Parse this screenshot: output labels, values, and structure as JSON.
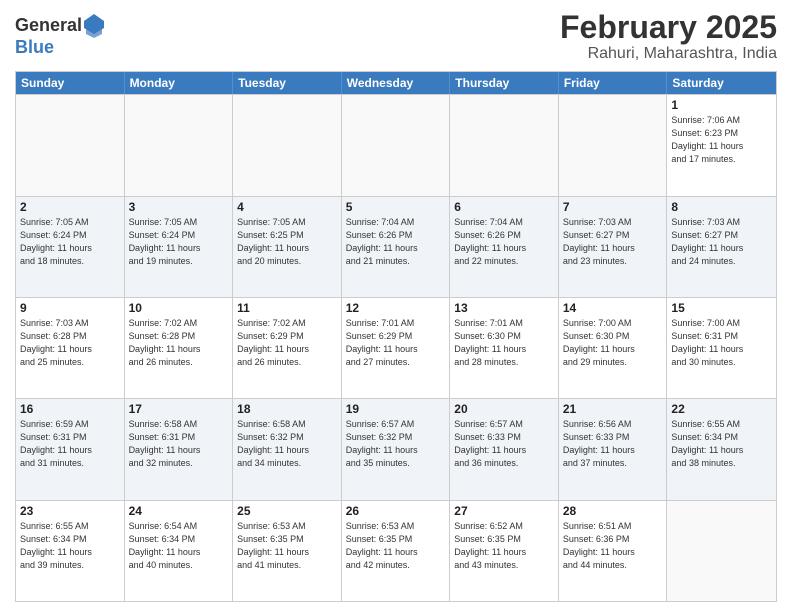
{
  "header": {
    "logo_general": "General",
    "logo_blue": "Blue",
    "title": "February 2025",
    "subtitle": "Rahuri, Maharashtra, India"
  },
  "weekdays": [
    "Sunday",
    "Monday",
    "Tuesday",
    "Wednesday",
    "Thursday",
    "Friday",
    "Saturday"
  ],
  "weeks": [
    [
      {
        "day": "",
        "info": ""
      },
      {
        "day": "",
        "info": ""
      },
      {
        "day": "",
        "info": ""
      },
      {
        "day": "",
        "info": ""
      },
      {
        "day": "",
        "info": ""
      },
      {
        "day": "",
        "info": ""
      },
      {
        "day": "1",
        "info": "Sunrise: 7:06 AM\nSunset: 6:23 PM\nDaylight: 11 hours\nand 17 minutes."
      }
    ],
    [
      {
        "day": "2",
        "info": "Sunrise: 7:05 AM\nSunset: 6:24 PM\nDaylight: 11 hours\nand 18 minutes."
      },
      {
        "day": "3",
        "info": "Sunrise: 7:05 AM\nSunset: 6:24 PM\nDaylight: 11 hours\nand 19 minutes."
      },
      {
        "day": "4",
        "info": "Sunrise: 7:05 AM\nSunset: 6:25 PM\nDaylight: 11 hours\nand 20 minutes."
      },
      {
        "day": "5",
        "info": "Sunrise: 7:04 AM\nSunset: 6:26 PM\nDaylight: 11 hours\nand 21 minutes."
      },
      {
        "day": "6",
        "info": "Sunrise: 7:04 AM\nSunset: 6:26 PM\nDaylight: 11 hours\nand 22 minutes."
      },
      {
        "day": "7",
        "info": "Sunrise: 7:03 AM\nSunset: 6:27 PM\nDaylight: 11 hours\nand 23 minutes."
      },
      {
        "day": "8",
        "info": "Sunrise: 7:03 AM\nSunset: 6:27 PM\nDaylight: 11 hours\nand 24 minutes."
      }
    ],
    [
      {
        "day": "9",
        "info": "Sunrise: 7:03 AM\nSunset: 6:28 PM\nDaylight: 11 hours\nand 25 minutes."
      },
      {
        "day": "10",
        "info": "Sunrise: 7:02 AM\nSunset: 6:28 PM\nDaylight: 11 hours\nand 26 minutes."
      },
      {
        "day": "11",
        "info": "Sunrise: 7:02 AM\nSunset: 6:29 PM\nDaylight: 11 hours\nand 26 minutes."
      },
      {
        "day": "12",
        "info": "Sunrise: 7:01 AM\nSunset: 6:29 PM\nDaylight: 11 hours\nand 27 minutes."
      },
      {
        "day": "13",
        "info": "Sunrise: 7:01 AM\nSunset: 6:30 PM\nDaylight: 11 hours\nand 28 minutes."
      },
      {
        "day": "14",
        "info": "Sunrise: 7:00 AM\nSunset: 6:30 PM\nDaylight: 11 hours\nand 29 minutes."
      },
      {
        "day": "15",
        "info": "Sunrise: 7:00 AM\nSunset: 6:31 PM\nDaylight: 11 hours\nand 30 minutes."
      }
    ],
    [
      {
        "day": "16",
        "info": "Sunrise: 6:59 AM\nSunset: 6:31 PM\nDaylight: 11 hours\nand 31 minutes."
      },
      {
        "day": "17",
        "info": "Sunrise: 6:58 AM\nSunset: 6:31 PM\nDaylight: 11 hours\nand 32 minutes."
      },
      {
        "day": "18",
        "info": "Sunrise: 6:58 AM\nSunset: 6:32 PM\nDaylight: 11 hours\nand 34 minutes."
      },
      {
        "day": "19",
        "info": "Sunrise: 6:57 AM\nSunset: 6:32 PM\nDaylight: 11 hours\nand 35 minutes."
      },
      {
        "day": "20",
        "info": "Sunrise: 6:57 AM\nSunset: 6:33 PM\nDaylight: 11 hours\nand 36 minutes."
      },
      {
        "day": "21",
        "info": "Sunrise: 6:56 AM\nSunset: 6:33 PM\nDaylight: 11 hours\nand 37 minutes."
      },
      {
        "day": "22",
        "info": "Sunrise: 6:55 AM\nSunset: 6:34 PM\nDaylight: 11 hours\nand 38 minutes."
      }
    ],
    [
      {
        "day": "23",
        "info": "Sunrise: 6:55 AM\nSunset: 6:34 PM\nDaylight: 11 hours\nand 39 minutes."
      },
      {
        "day": "24",
        "info": "Sunrise: 6:54 AM\nSunset: 6:34 PM\nDaylight: 11 hours\nand 40 minutes."
      },
      {
        "day": "25",
        "info": "Sunrise: 6:53 AM\nSunset: 6:35 PM\nDaylight: 11 hours\nand 41 minutes."
      },
      {
        "day": "26",
        "info": "Sunrise: 6:53 AM\nSunset: 6:35 PM\nDaylight: 11 hours\nand 42 minutes."
      },
      {
        "day": "27",
        "info": "Sunrise: 6:52 AM\nSunset: 6:35 PM\nDaylight: 11 hours\nand 43 minutes."
      },
      {
        "day": "28",
        "info": "Sunrise: 6:51 AM\nSunset: 6:36 PM\nDaylight: 11 hours\nand 44 minutes."
      },
      {
        "day": "",
        "info": ""
      }
    ]
  ]
}
